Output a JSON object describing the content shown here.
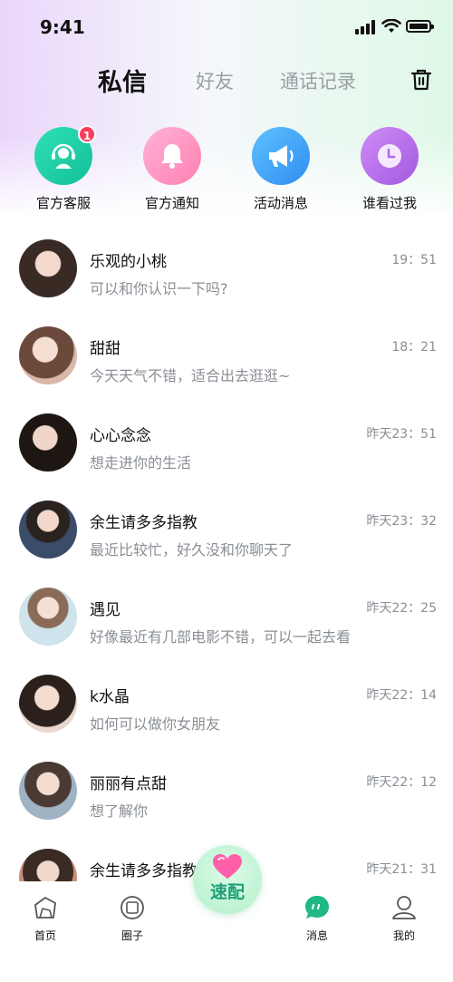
{
  "status": {
    "time": "9:41"
  },
  "tabs": [
    {
      "label": "私信",
      "active": true
    },
    {
      "label": "好友",
      "active": false
    },
    {
      "label": "通话记录",
      "active": false
    }
  ],
  "quick": [
    {
      "label": "官方客服",
      "icon": "customer-service-icon",
      "badge": "1",
      "color": "#22d3a5"
    },
    {
      "label": "官方通知",
      "icon": "bell-icon",
      "badge": "",
      "color": "#ff8fc0"
    },
    {
      "label": "活动消息",
      "icon": "megaphone-icon",
      "badge": "",
      "color": "#3da3f5"
    },
    {
      "label": "谁看过我",
      "icon": "clock-icon",
      "badge": "",
      "color": "#b66ae8"
    }
  ],
  "messages": [
    {
      "name": "乐观的小桃",
      "preview": "可以和你认识一下吗?",
      "time": "19：51"
    },
    {
      "name": "甜甜",
      "preview": "今天天气不错，适合出去逛逛~",
      "time": "18：21"
    },
    {
      "name": "心心念念",
      "preview": "想走进你的生活",
      "time": "昨天23：51"
    },
    {
      "name": "余生请多多指教",
      "preview": "最近比较忙，好久没和你聊天了",
      "time": "昨天23：32"
    },
    {
      "name": "遇见",
      "preview": "好像最近有几部电影不错，可以一起去看",
      "time": "昨天22：25"
    },
    {
      "name": "k水晶",
      "preview": "如何可以做你女朋友",
      "time": "昨天22：14"
    },
    {
      "name": "丽丽有点甜",
      "preview": "想了解你",
      "time": "昨天22：12"
    },
    {
      "name": "余生请多多指教",
      "preview": "",
      "time": "昨天21：31"
    }
  ],
  "nav": {
    "home": "首页",
    "circle": "圈子",
    "match": "速配",
    "messages": "消息",
    "me": "我的"
  },
  "colors": {
    "accent": "#1fa077",
    "badge": "#ff3b5c"
  }
}
